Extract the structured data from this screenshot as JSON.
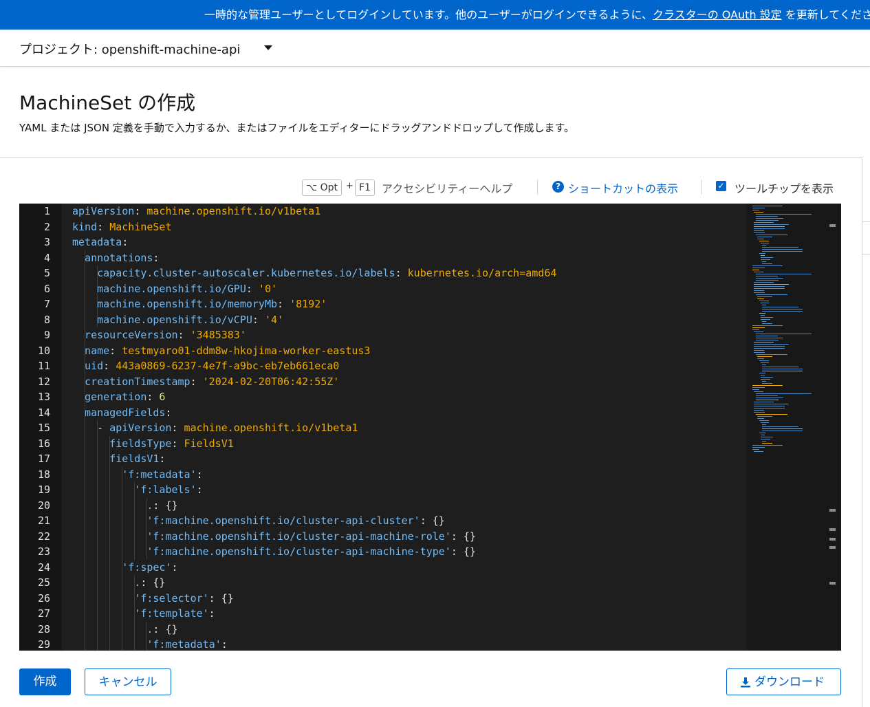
{
  "banner": {
    "prefix": "一時的な管理ユーザーとしてログインしています。他のユーザーがログインできるように、",
    "link": "クラスターの OAuth 設定",
    "suffix": " を更新してください。"
  },
  "project": {
    "label": "プロジェクト: openshift-machine-api"
  },
  "page": {
    "title": "MachineSet の作成",
    "description": "YAML または JSON 定義を手動で入力するか、またはファイルをエディターにドラッグアンドドロップして作成します。"
  },
  "toolbar": {
    "key1": "⌥ Opt",
    "plus": "+",
    "key2": "F1",
    "accessibility_help": "アクセシビリティーヘルプ",
    "help_icon": "?",
    "shortcuts": "ショートカットの表示",
    "tooltips_checked": true,
    "tooltips_label": "ツールチップを表示"
  },
  "editor": {
    "lines": [
      {
        "n": "1",
        "indent": 0,
        "tokens": [
          [
            "k",
            "apiVersion"
          ],
          [
            "p",
            ": "
          ],
          [
            "s",
            "machine.openshift.io/v1beta1"
          ]
        ]
      },
      {
        "n": "2",
        "indent": 0,
        "tokens": [
          [
            "k",
            "kind"
          ],
          [
            "p",
            ": "
          ],
          [
            "s",
            "MachineSet"
          ]
        ]
      },
      {
        "n": "3",
        "indent": 0,
        "tokens": [
          [
            "k",
            "metadata"
          ],
          [
            "p",
            ":"
          ]
        ]
      },
      {
        "n": "4",
        "indent": 2,
        "tokens": [
          [
            "k",
            "annotations"
          ],
          [
            "p",
            ":"
          ]
        ]
      },
      {
        "n": "5",
        "indent": 4,
        "tokens": [
          [
            "k",
            "capacity.cluster-autoscaler.kubernetes.io/labels"
          ],
          [
            "p",
            ": "
          ],
          [
            "s",
            "kubernetes.io/arch=amd64"
          ]
        ]
      },
      {
        "n": "6",
        "indent": 4,
        "tokens": [
          [
            "k",
            "machine.openshift.io/GPU"
          ],
          [
            "p",
            ": "
          ],
          [
            "s",
            "'0'"
          ]
        ]
      },
      {
        "n": "7",
        "indent": 4,
        "tokens": [
          [
            "k",
            "machine.openshift.io/memoryMb"
          ],
          [
            "p",
            ": "
          ],
          [
            "s",
            "'8192'"
          ]
        ]
      },
      {
        "n": "8",
        "indent": 4,
        "tokens": [
          [
            "k",
            "machine.openshift.io/vCPU"
          ],
          [
            "p",
            ": "
          ],
          [
            "s",
            "'4'"
          ]
        ]
      },
      {
        "n": "9",
        "indent": 2,
        "tokens": [
          [
            "k",
            "resourceVersion"
          ],
          [
            "p",
            ": "
          ],
          [
            "s",
            "'3485383'"
          ]
        ]
      },
      {
        "n": "10",
        "indent": 2,
        "tokens": [
          [
            "k",
            "name"
          ],
          [
            "p",
            ": "
          ],
          [
            "s",
            "testmyaro01-ddm8w-hkojima-worker-eastus3"
          ]
        ]
      },
      {
        "n": "11",
        "indent": 2,
        "tokens": [
          [
            "k",
            "uid"
          ],
          [
            "p",
            ": "
          ],
          [
            "s",
            "443a0869-6237-4e7f-a9bc-eb7eb661eca0"
          ]
        ]
      },
      {
        "n": "12",
        "indent": 2,
        "tokens": [
          [
            "k",
            "creationTimestamp"
          ],
          [
            "p",
            ": "
          ],
          [
            "s",
            "'2024-02-20T06:42:55Z'"
          ]
        ]
      },
      {
        "n": "13",
        "indent": 2,
        "tokens": [
          [
            "k",
            "generation"
          ],
          [
            "p",
            ": "
          ],
          [
            "n",
            "6"
          ]
        ]
      },
      {
        "n": "14",
        "indent": 2,
        "tokens": [
          [
            "k",
            "managedFields"
          ],
          [
            "p",
            ":"
          ]
        ]
      },
      {
        "n": "15",
        "indent": 4,
        "tokens": [
          [
            "p",
            "- "
          ],
          [
            "k",
            "apiVersion"
          ],
          [
            "p",
            ": "
          ],
          [
            "s",
            "machine.openshift.io/v1beta1"
          ]
        ]
      },
      {
        "n": "16",
        "indent": 6,
        "tokens": [
          [
            "k",
            "fieldsType"
          ],
          [
            "p",
            ": "
          ],
          [
            "s",
            "FieldsV1"
          ]
        ]
      },
      {
        "n": "17",
        "indent": 6,
        "tokens": [
          [
            "k",
            "fieldsV1"
          ],
          [
            "p",
            ":"
          ]
        ]
      },
      {
        "n": "18",
        "indent": 8,
        "tokens": [
          [
            "k",
            "'f:metadata'"
          ],
          [
            "p",
            ":"
          ]
        ]
      },
      {
        "n": "19",
        "indent": 10,
        "tokens": [
          [
            "k",
            "'f:labels'"
          ],
          [
            "p",
            ":"
          ]
        ]
      },
      {
        "n": "20",
        "indent": 12,
        "tokens": [
          [
            "k",
            "."
          ],
          [
            "p",
            ": {}"
          ]
        ]
      },
      {
        "n": "21",
        "indent": 12,
        "tokens": [
          [
            "k",
            "'f:machine.openshift.io/cluster-api-cluster'"
          ],
          [
            "p",
            ": {}"
          ]
        ]
      },
      {
        "n": "22",
        "indent": 12,
        "tokens": [
          [
            "k",
            "'f:machine.openshift.io/cluster-api-machine-role'"
          ],
          [
            "p",
            ": {}"
          ]
        ]
      },
      {
        "n": "23",
        "indent": 12,
        "tokens": [
          [
            "k",
            "'f:machine.openshift.io/cluster-api-machine-type'"
          ],
          [
            "p",
            ": {}"
          ]
        ]
      },
      {
        "n": "24",
        "indent": 8,
        "tokens": [
          [
            "k",
            "'f:spec'"
          ],
          [
            "p",
            ":"
          ]
        ]
      },
      {
        "n": "25",
        "indent": 10,
        "tokens": [
          [
            "k",
            "."
          ],
          [
            "p",
            ": {}"
          ]
        ]
      },
      {
        "n": "26",
        "indent": 10,
        "tokens": [
          [
            "k",
            "'f:selector'"
          ],
          [
            "p",
            ": {}"
          ]
        ]
      },
      {
        "n": "27",
        "indent": 10,
        "tokens": [
          [
            "k",
            "'f:template'"
          ],
          [
            "p",
            ":"
          ]
        ]
      },
      {
        "n": "28",
        "indent": 12,
        "tokens": [
          [
            "k",
            "."
          ],
          [
            "p",
            ": {}"
          ]
        ]
      },
      {
        "n": "29",
        "indent": 12,
        "tokens": [
          [
            "k",
            "'f:metadata'"
          ],
          [
            "p",
            ":"
          ]
        ]
      }
    ]
  },
  "actions": {
    "create": "作成",
    "cancel": "キャンセル",
    "download": "ダウンロード"
  },
  "colors": {
    "accent": "#0066cc",
    "editor_bg": "#1e1e1e",
    "yaml_key": "#73bcf7",
    "yaml_string": "#f0ab00",
    "yaml_number": "#c9f27a"
  },
  "icons": [
    "help-icon",
    "checkbox-checked-icon",
    "caret-down-icon",
    "download-icon"
  ]
}
